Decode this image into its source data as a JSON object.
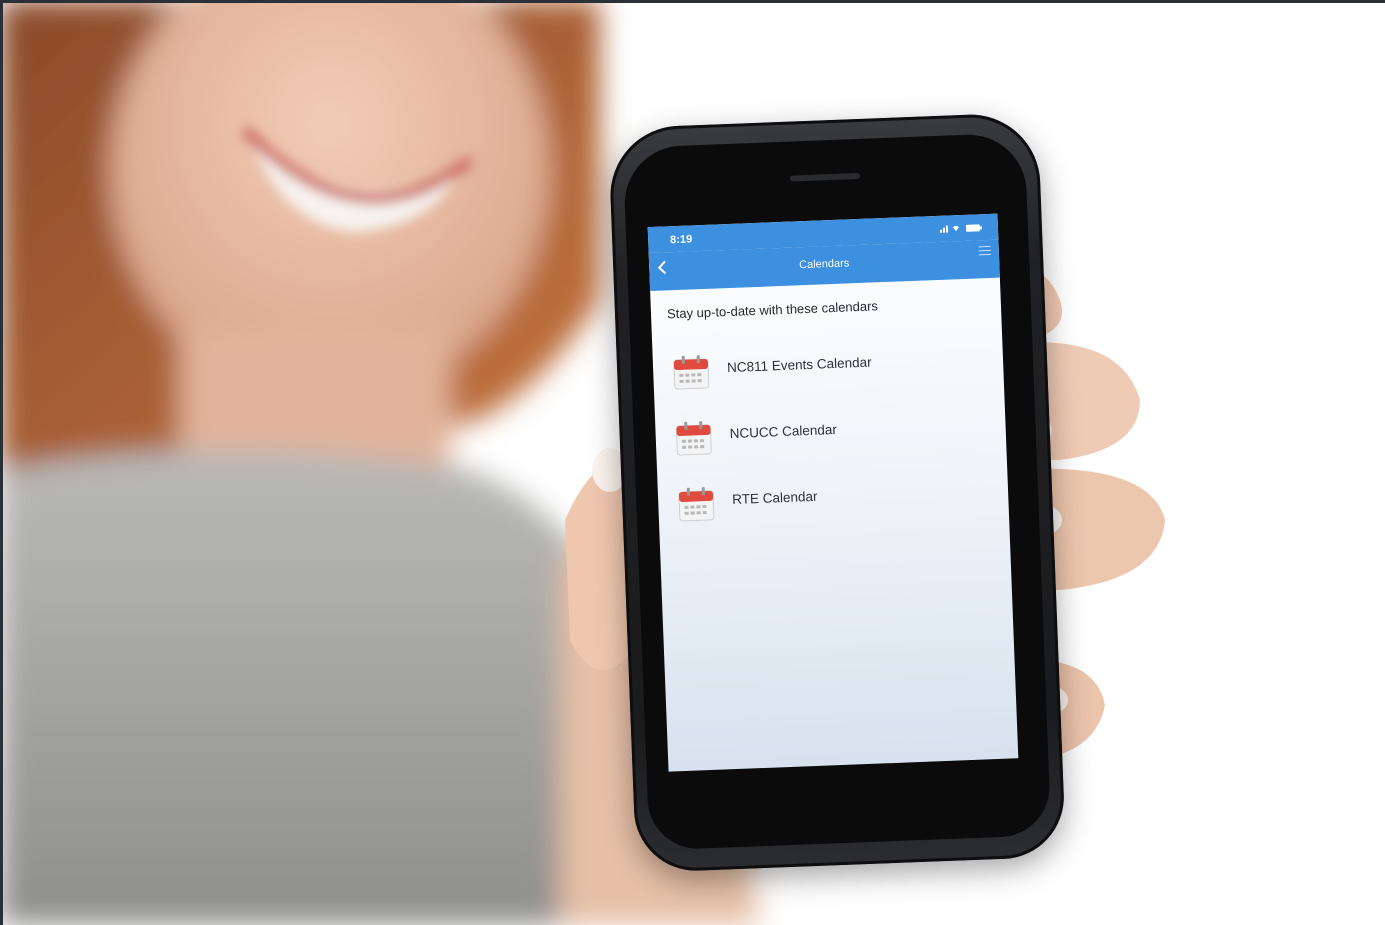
{
  "status_bar": {
    "time": "8:19"
  },
  "nav": {
    "title": "Calendars",
    "back_icon": "chevron-left-icon",
    "menu_icon": "hamburger-menu-icon"
  },
  "intro": {
    "text": "Stay up-to-date with these calendars"
  },
  "calendars": [
    {
      "label": "NC811 Events Calendar",
      "icon": "calendar-icon"
    },
    {
      "label": "NCUCC Calendar",
      "icon": "calendar-icon"
    },
    {
      "label": "RTE Calendar",
      "icon": "calendar-icon"
    }
  ],
  "colors": {
    "header_blue": "#3d8fe0",
    "calendar_red": "#e14b3f"
  }
}
